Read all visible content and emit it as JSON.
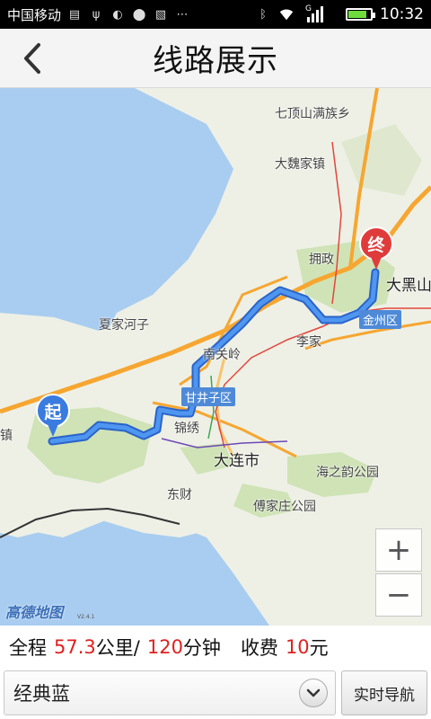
{
  "status_bar": {
    "carrier": "中国移动",
    "network_label": "G",
    "time": "10:32",
    "battery_level": 0.85
  },
  "header": {
    "title": "线路展示",
    "back_icon": "chevron-left-icon"
  },
  "map": {
    "labels": {
      "qidingshan": "七顶山满族乡",
      "daweijia": "大魏家镇",
      "xiajiahezi": "夏家河子",
      "nanguanling": "南关岭",
      "lijia": "李家",
      "jinxiu": "锦绣",
      "dalian": "大连市",
      "dongcai": "东财",
      "haizhiyun": "海之韵公园",
      "fujiazhuang": "傅家庄公园",
      "yongzheng": "拥政",
      "daheishan": "大黑山",
      "left_edge": "镇"
    },
    "tags": {
      "jinzhou": "金州区",
      "ganjingzi": "甘井子区"
    },
    "start_pin": "起",
    "end_pin": "终",
    "zoom_in": "+",
    "zoom_out": "−",
    "logo": "高德地图",
    "logo_version": "V2.4.1",
    "colors": {
      "water": "#a9cdf0",
      "route": "#3a82e6",
      "start_pin": "#3a7be0",
      "end_pin": "#e03b3b",
      "highway": "#f6a631"
    }
  },
  "summary": {
    "total_label": "全程",
    "distance": "57.3",
    "distance_unit": "公里/",
    "duration": "120",
    "duration_unit": "分钟",
    "toll_label": "收费",
    "toll": "10",
    "toll_unit": "元"
  },
  "controls": {
    "style_select_value": "经典蓝",
    "nav_button": "实时导航"
  }
}
